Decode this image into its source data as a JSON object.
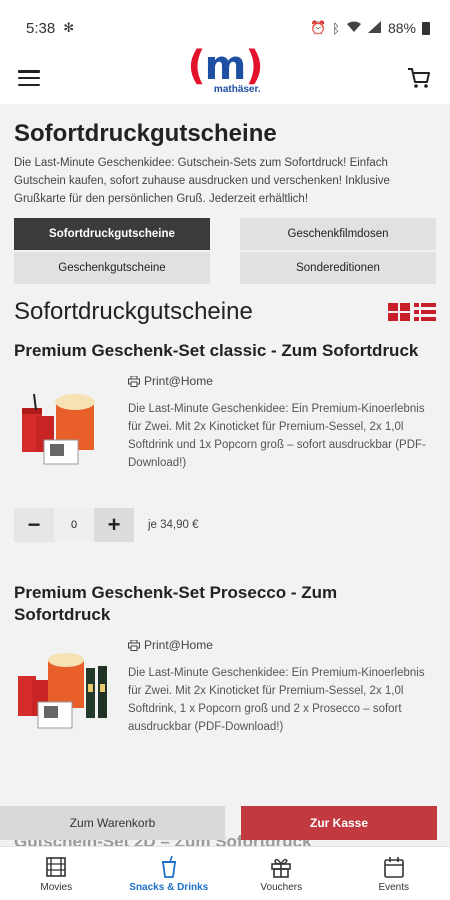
{
  "status": {
    "time": "5:38",
    "battery": "88%"
  },
  "header": {
    "logo_mark": "m",
    "logo_text": "mathäser."
  },
  "page": {
    "title": "Sofortdruckgutscheine",
    "intro": "Die Last-Minute Geschenkidee: Gutschein-Sets zum Sofortdruck! Einfach Gutschein kaufen, sofort zuhause ausdrucken und verschenken! Inklusive Grußkarte für den persönlichen Gruß. Jederzeit erhältlich!"
  },
  "tabs": [
    {
      "label": "Sofortdruckgutscheine"
    },
    {
      "label": "Geschenkgutscheine"
    },
    {
      "label": "Geschenkfilmdosen"
    },
    {
      "label": "Sondereditionen"
    }
  ],
  "section": {
    "title": "Sofortdruckgutscheine"
  },
  "products": [
    {
      "title": "Premium Geschenk-Set classic - Zum Sofortdruck",
      "tag": "Print@Home",
      "desc": "Die Last-Minute Geschenkidee: Ein Premium-Kinoerlebnis für Zwei. Mit 2x Kinoticket für Premium-Sessel, 2x 1,0l Softdrink und 1x Popcorn groß – sofort ausdruckbar (PDF-Download!)",
      "qty": "0",
      "price": "je 34,90 €"
    },
    {
      "title": "Premium Geschenk-Set Prosecco - Zum Sofortdruck",
      "tag": "Print@Home",
      "desc": "Die Last-Minute Geschenkidee: Ein Premium-Kinoerlebnis für Zwei. Mit 2x Kinoticket für Premium-Sessel, 2x 1,0l Softdrink, 1 x Popcorn groß und 2 x Prosecco – sofort ausdruckbar (PDF-Download!)"
    }
  ],
  "overlap_title": "Gutschein-Set 2D – Zum Sofortdruck",
  "actions": {
    "cart": "Zum Warenkorb",
    "checkout": "Zur Kasse"
  },
  "nav": [
    {
      "label": "Movies",
      "icon": "film-icon"
    },
    {
      "label": "Snacks & Drinks",
      "icon": "cup-icon"
    },
    {
      "label": "Vouchers",
      "icon": "gift-icon"
    },
    {
      "label": "Events",
      "icon": "calendar-icon"
    }
  ],
  "colors": {
    "brand_blue": "#1e4fa3",
    "brand_red": "#e3122b",
    "checkout": "#c2393f",
    "active_nav": "#1e6fc8"
  }
}
